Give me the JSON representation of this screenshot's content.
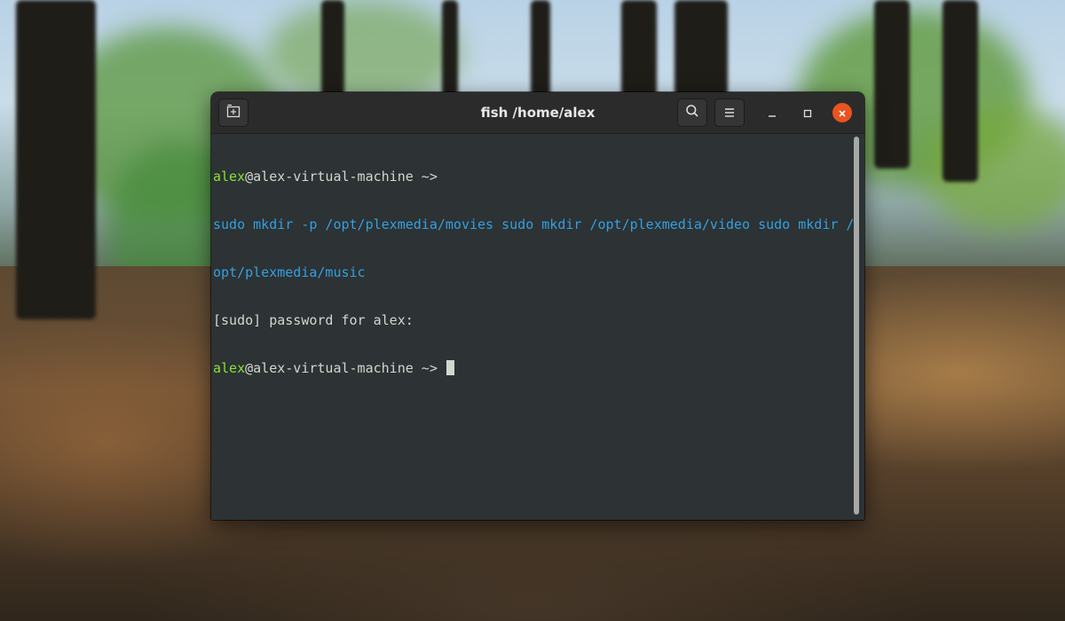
{
  "window": {
    "title": "fish /home/alex"
  },
  "icons": {
    "new_tab": "new-tab-icon",
    "search": "search-icon",
    "menu": "hamburger-menu-icon",
    "minimize": "minimize-icon",
    "maximize": "maximize-icon",
    "close": "close-icon"
  },
  "colors": {
    "terminal_bg": "#2d3234",
    "prompt_user": "#8ae234",
    "command_text": "#34a0e0",
    "close_button": "#e95420"
  },
  "terminal": {
    "prompt1_user": "alex",
    "prompt1_host": "@alex-virtual-machine ~>",
    "command_line1": "sudo mkdir -p /opt/plexmedia/movies sudo mkdir /opt/plexmedia/video sudo mkdir /",
    "command_line2": "opt/plexmedia/music",
    "output_line": "[sudo] password for alex:",
    "prompt2_user": "alex",
    "prompt2_host": "@alex-virtual-machine ~>"
  }
}
